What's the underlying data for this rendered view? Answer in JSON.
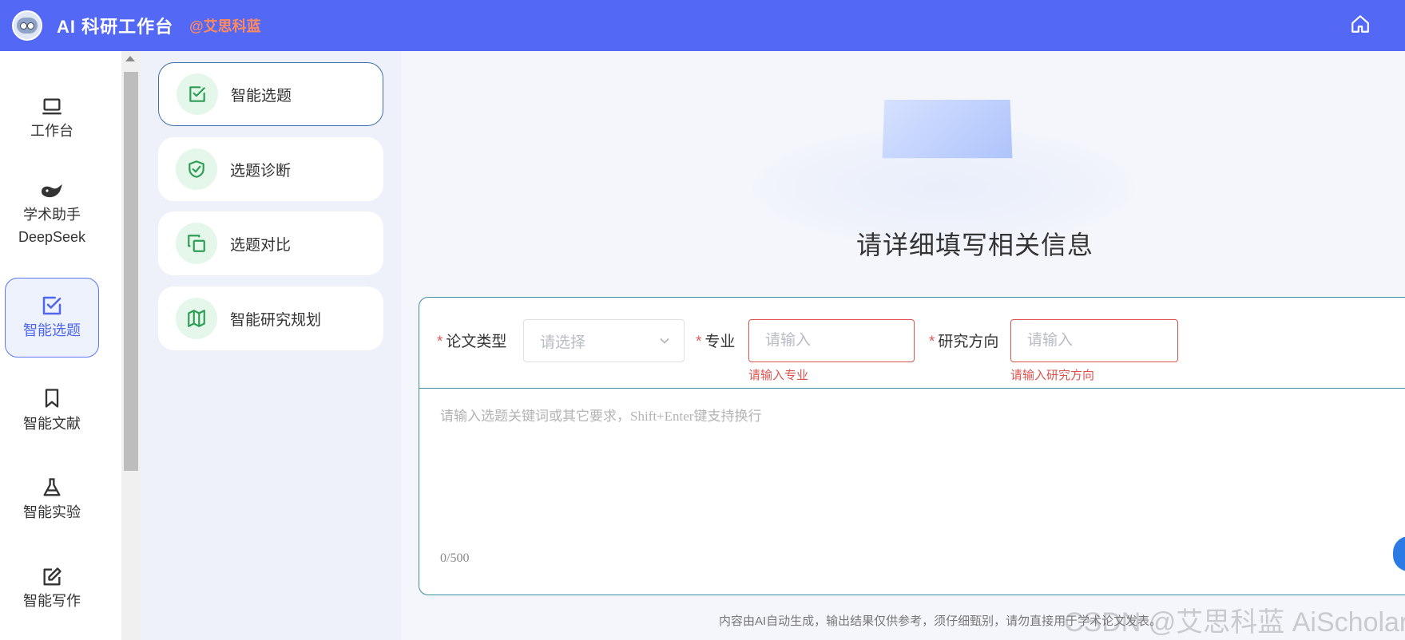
{
  "header": {
    "title": "AI 科研工作台",
    "handle": "@艾思科蓝"
  },
  "leftnav": {
    "items": [
      {
        "label": "工作台"
      },
      {
        "label": "学术助手",
        "sublabel": "DeepSeek"
      },
      {
        "label": "智能选题"
      },
      {
        "label": "智能文献"
      },
      {
        "label": "智能实验"
      },
      {
        "label": "智能写作"
      }
    ],
    "active": "智能选题"
  },
  "submenu": {
    "items": [
      {
        "label": "智能选题"
      },
      {
        "label": "选题诊断"
      },
      {
        "label": "选题对比"
      },
      {
        "label": "智能研究规划"
      }
    ],
    "active": "智能选题"
  },
  "main": {
    "title": "请详细填写相关信息",
    "form": {
      "paper_type": {
        "label": "论文类型",
        "placeholder": "请选择"
      },
      "major": {
        "label": "专业",
        "placeholder": "请输入",
        "error": "请输入专业"
      },
      "direction": {
        "label": "研究方向",
        "placeholder": "请输入",
        "error": "请输入研究方向"
      },
      "prompt": {
        "placeholder": "请输入选题关键词或其它要求，Shift+Enter键支持换行"
      },
      "counter": "0/500",
      "required_mark": "*"
    },
    "disclaimer": "内容由AI自动生成，输出结果仅供参考，须仔细甄别，请勿直接用于学术论文发表。",
    "watermark": "CSDN @艾思科蓝 AiScholar"
  },
  "colors": {
    "header_bg": "#5468f6",
    "accent": "#4e66f0",
    "success_icon": "#2e9e55",
    "error": "#d9534f",
    "card_border": "#3c8fa2"
  }
}
